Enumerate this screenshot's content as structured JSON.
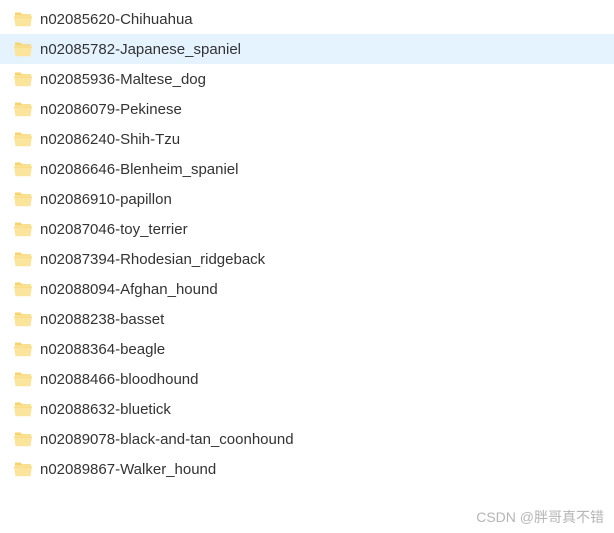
{
  "folders": [
    {
      "name": "n02085620-Chihuahua",
      "selected": false
    },
    {
      "name": "n02085782-Japanese_spaniel",
      "selected": true
    },
    {
      "name": "n02085936-Maltese_dog",
      "selected": false
    },
    {
      "name": "n02086079-Pekinese",
      "selected": false
    },
    {
      "name": "n02086240-Shih-Tzu",
      "selected": false
    },
    {
      "name": "n02086646-Blenheim_spaniel",
      "selected": false
    },
    {
      "name": "n02086910-papillon",
      "selected": false
    },
    {
      "name": "n02087046-toy_terrier",
      "selected": false
    },
    {
      "name": "n02087394-Rhodesian_ridgeback",
      "selected": false
    },
    {
      "name": "n02088094-Afghan_hound",
      "selected": false
    },
    {
      "name": "n02088238-basset",
      "selected": false
    },
    {
      "name": "n02088364-beagle",
      "selected": false
    },
    {
      "name": "n02088466-bloodhound",
      "selected": false
    },
    {
      "name": "n02088632-bluetick",
      "selected": false
    },
    {
      "name": "n02089078-black-and-tan_coonhound",
      "selected": false
    },
    {
      "name": "n02089867-Walker_hound",
      "selected": false
    }
  ],
  "watermark": "CSDN @胖哥真不错"
}
